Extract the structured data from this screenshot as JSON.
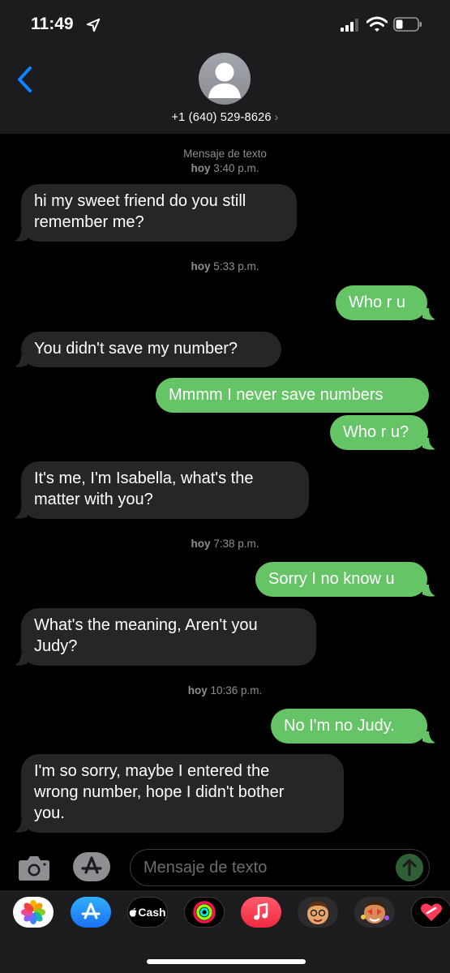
{
  "status": {
    "time": "11:49"
  },
  "contact": {
    "name": "+1 (640) 529-8626",
    "chevron": "›"
  },
  "thread": {
    "header_label": "Mensaje de texto",
    "timestamps": [
      {
        "day": "hoy",
        "time": "3:40 p.m."
      },
      {
        "day": "hoy",
        "time": "5:33 p.m."
      },
      {
        "day": "hoy",
        "time": "7:38 p.m."
      },
      {
        "day": "hoy",
        "time": "10:36 p.m."
      }
    ],
    "messages": [
      {
        "dir": "in",
        "lines": [
          "hi my sweet friend do you still",
          "remember me?"
        ]
      },
      {
        "dir": "out",
        "lines": [
          "Who r u"
        ]
      },
      {
        "dir": "in",
        "lines": [
          "You didn't save my number?"
        ]
      },
      {
        "dir": "out",
        "lines": [
          "Mmmm I never save numbers"
        ]
      },
      {
        "dir": "out",
        "lines": [
          "Who r u?"
        ]
      },
      {
        "dir": "in",
        "lines": [
          "It's me, I'm Isabella, what's the",
          "matter with you?"
        ]
      },
      {
        "dir": "out",
        "lines": [
          "Sorry I no know u"
        ]
      },
      {
        "dir": "in",
        "lines": [
          "What's the meaning,  Aren't you",
          "Judy?"
        ]
      },
      {
        "dir": "out",
        "lines": [
          "No I'm no Judy."
        ]
      },
      {
        "dir": "in",
        "lines": [
          "I'm so sorry, maybe I entered the",
          "wrong number, hope I didn't bother",
          "you."
        ]
      }
    ]
  },
  "composer": {
    "placeholder": "Mensaje de texto"
  },
  "tray": {
    "apps": [
      {
        "name": "photos",
        "icon": "photos-icon"
      },
      {
        "name": "app-store",
        "icon": "app-store-icon"
      },
      {
        "name": "apple-cash",
        "icon": "apple-cash-icon",
        "label": "Cash"
      },
      {
        "name": "activity",
        "icon": "activity-icon"
      },
      {
        "name": "music",
        "icon": "music-icon"
      },
      {
        "name": "memoji",
        "icon": "memoji-icon"
      },
      {
        "name": "memoji-stickers",
        "icon": "memoji-stickers-icon"
      },
      {
        "name": "digital-touch",
        "icon": "digital-touch-icon"
      }
    ]
  },
  "colors": {
    "incoming": "#262629",
    "outgoing": "#65c466",
    "accent": "#0a84ff"
  }
}
